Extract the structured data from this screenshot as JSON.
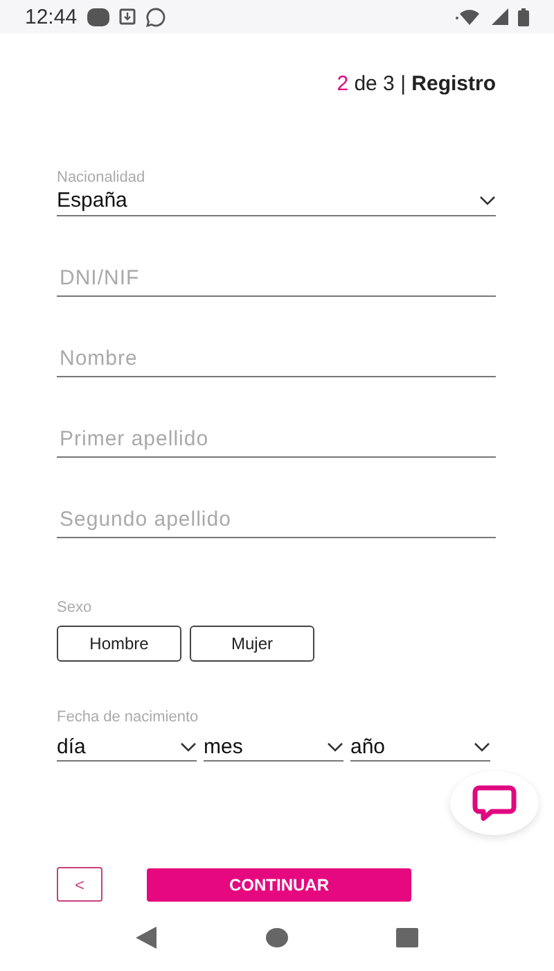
{
  "status_bar": {
    "time": "12:44"
  },
  "step": {
    "current": "2",
    "rest": "de 3",
    "separator": "|",
    "title": "Registro"
  },
  "nationality": {
    "label": "Nacionalidad",
    "value": "España"
  },
  "fields": [
    {
      "placeholder": "DNI/NIF"
    },
    {
      "placeholder": "Nombre"
    },
    {
      "placeholder": "Primer apellido"
    },
    {
      "placeholder": "Segundo apellido"
    }
  ],
  "sex": {
    "label": "Sexo",
    "options": [
      {
        "label": "Hombre",
        "selected": false
      },
      {
        "label": "Mujer",
        "selected": false
      }
    ]
  },
  "birth_date": {
    "label": "Fecha de nacimiento",
    "selects": [
      {
        "value": "día"
      },
      {
        "value": "mes"
      },
      {
        "value": "año"
      }
    ]
  },
  "back_button": "<",
  "continue_button": "CONTINUAR"
}
